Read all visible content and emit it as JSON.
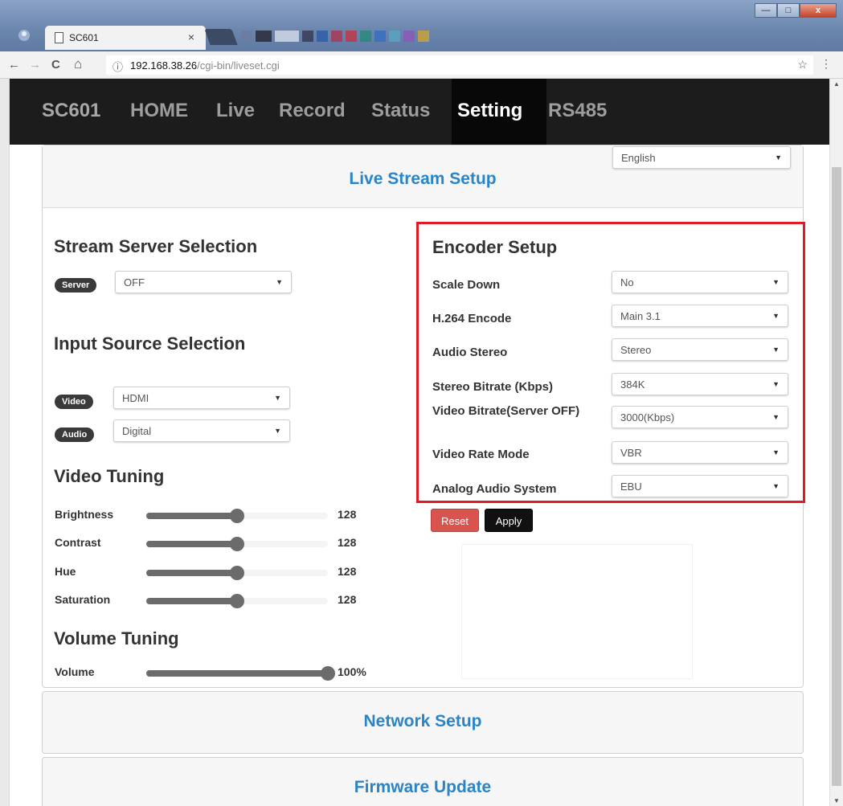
{
  "browser": {
    "tab_title": "SC601",
    "tab_close": "×",
    "url_host": "192.168.38.26",
    "url_path": "/cgi-bin/liveset.cgi",
    "url_info_icon": "ⓘ",
    "back_icon": "←",
    "forward_icon": "→",
    "reload_icon": "C",
    "home_icon": "⌂",
    "star_icon": "☆",
    "menu_icon": "⋮",
    "minimize": "—",
    "maximize": "□",
    "close": "x"
  },
  "navbar": {
    "brand": "SC601",
    "items": [
      "HOME",
      "Live",
      "Record",
      "Status",
      "Setting",
      "RS485"
    ],
    "active": "Setting"
  },
  "language": {
    "selected": "English"
  },
  "panels": {
    "live_stream_setup": "Live Stream Setup",
    "network_setup": "Network Setup",
    "firmware_update": "Firmware Update"
  },
  "stream_server": {
    "title": "Stream Server Selection",
    "server_label": "Server",
    "server_value": "OFF"
  },
  "input_source": {
    "title": "Input Source Selection",
    "video_label": "Video",
    "video_value": "HDMI",
    "audio_label": "Audio",
    "audio_value": "Digital"
  },
  "video_tuning": {
    "title": "Video Tuning",
    "rows": [
      {
        "label": "Brightness",
        "value": "128",
        "fraction": 0.5
      },
      {
        "label": "Contrast",
        "value": "128",
        "fraction": 0.5
      },
      {
        "label": "Hue",
        "value": "128",
        "fraction": 0.5
      },
      {
        "label": "Saturation",
        "value": "128",
        "fraction": 0.5
      }
    ]
  },
  "volume_tuning": {
    "title": "Volume Tuning",
    "rows": [
      {
        "label": "Volume",
        "value": "100%",
        "fraction": 1.0
      }
    ]
  },
  "encoder": {
    "title": "Encoder Setup",
    "rows": [
      {
        "label": "Scale Down",
        "value": "No"
      },
      {
        "label": "H.264 Encode",
        "value": "Main 3.1"
      },
      {
        "label": "Audio Stereo",
        "value": "Stereo"
      },
      {
        "label": "Stereo Bitrate (Kbps)",
        "value": "384K"
      },
      {
        "label": "Video Bitrate(Server OFF)",
        "value": "3000(Kbps)"
      },
      {
        "label": "Video Rate Mode",
        "value": "VBR"
      },
      {
        "label": "Analog Audio System",
        "value": "EBU"
      }
    ],
    "reset_label": "Reset",
    "apply_label": "Apply"
  },
  "colors": {
    "accent": "#2a85c7",
    "highlight_box": "#e01b24",
    "reset": "#d9534f",
    "apply": "#111111",
    "navbar": "#1c1c1c"
  },
  "caret": "▼"
}
